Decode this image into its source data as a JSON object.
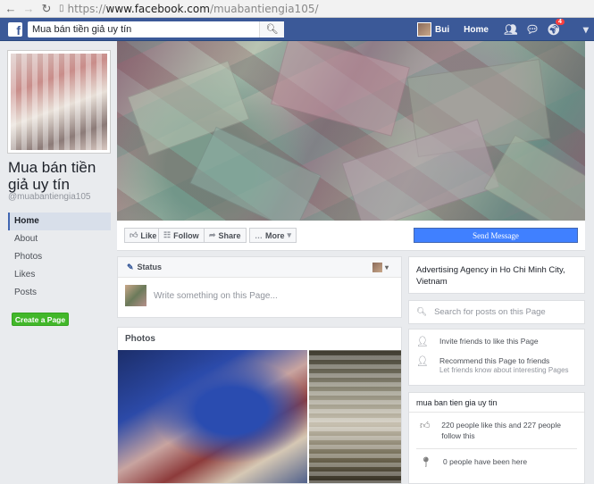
{
  "browser": {
    "back_icon": "←",
    "forward_icon": "→",
    "reload_icon": "↻",
    "url_scheme": "https://",
    "url_host": "www.facebook.com",
    "url_path": "/muabantiengia105/"
  },
  "topbar": {
    "logo": "f",
    "search_value": "Mua bán tiền giả uy tín",
    "user_name": "Bui",
    "home_label": "Home",
    "notification_count": "4",
    "brand_color": "#3b5998"
  },
  "page": {
    "name": "Mua bán tiền giả uy tín",
    "username": "@muabantiengia105",
    "nav": [
      "Home",
      "About",
      "Photos",
      "Likes",
      "Posts"
    ],
    "create_page_label": "Create a Page"
  },
  "actions": {
    "like": "Like",
    "follow": "Follow",
    "share": "Share",
    "more": "More",
    "send_message": "Send Message"
  },
  "composer": {
    "status_label": "Status",
    "placeholder": "Write something on this Page..."
  },
  "photos": {
    "title": "Photos"
  },
  "sidebar": {
    "category": "Advertising Agency in Ho Chi Minh City, Vietnam",
    "search_placeholder": "Search for posts on this Page",
    "invite_label": "Invite friends to like this Page",
    "recommend_label": "Recommend this Page to friends",
    "recommend_sub": "Let friends know about interesting Pages",
    "about_title": "mua ban tien gia uy tin",
    "likes_text": "220 people like this and 227 people follow this",
    "checkins_text": "0 people have been here"
  }
}
